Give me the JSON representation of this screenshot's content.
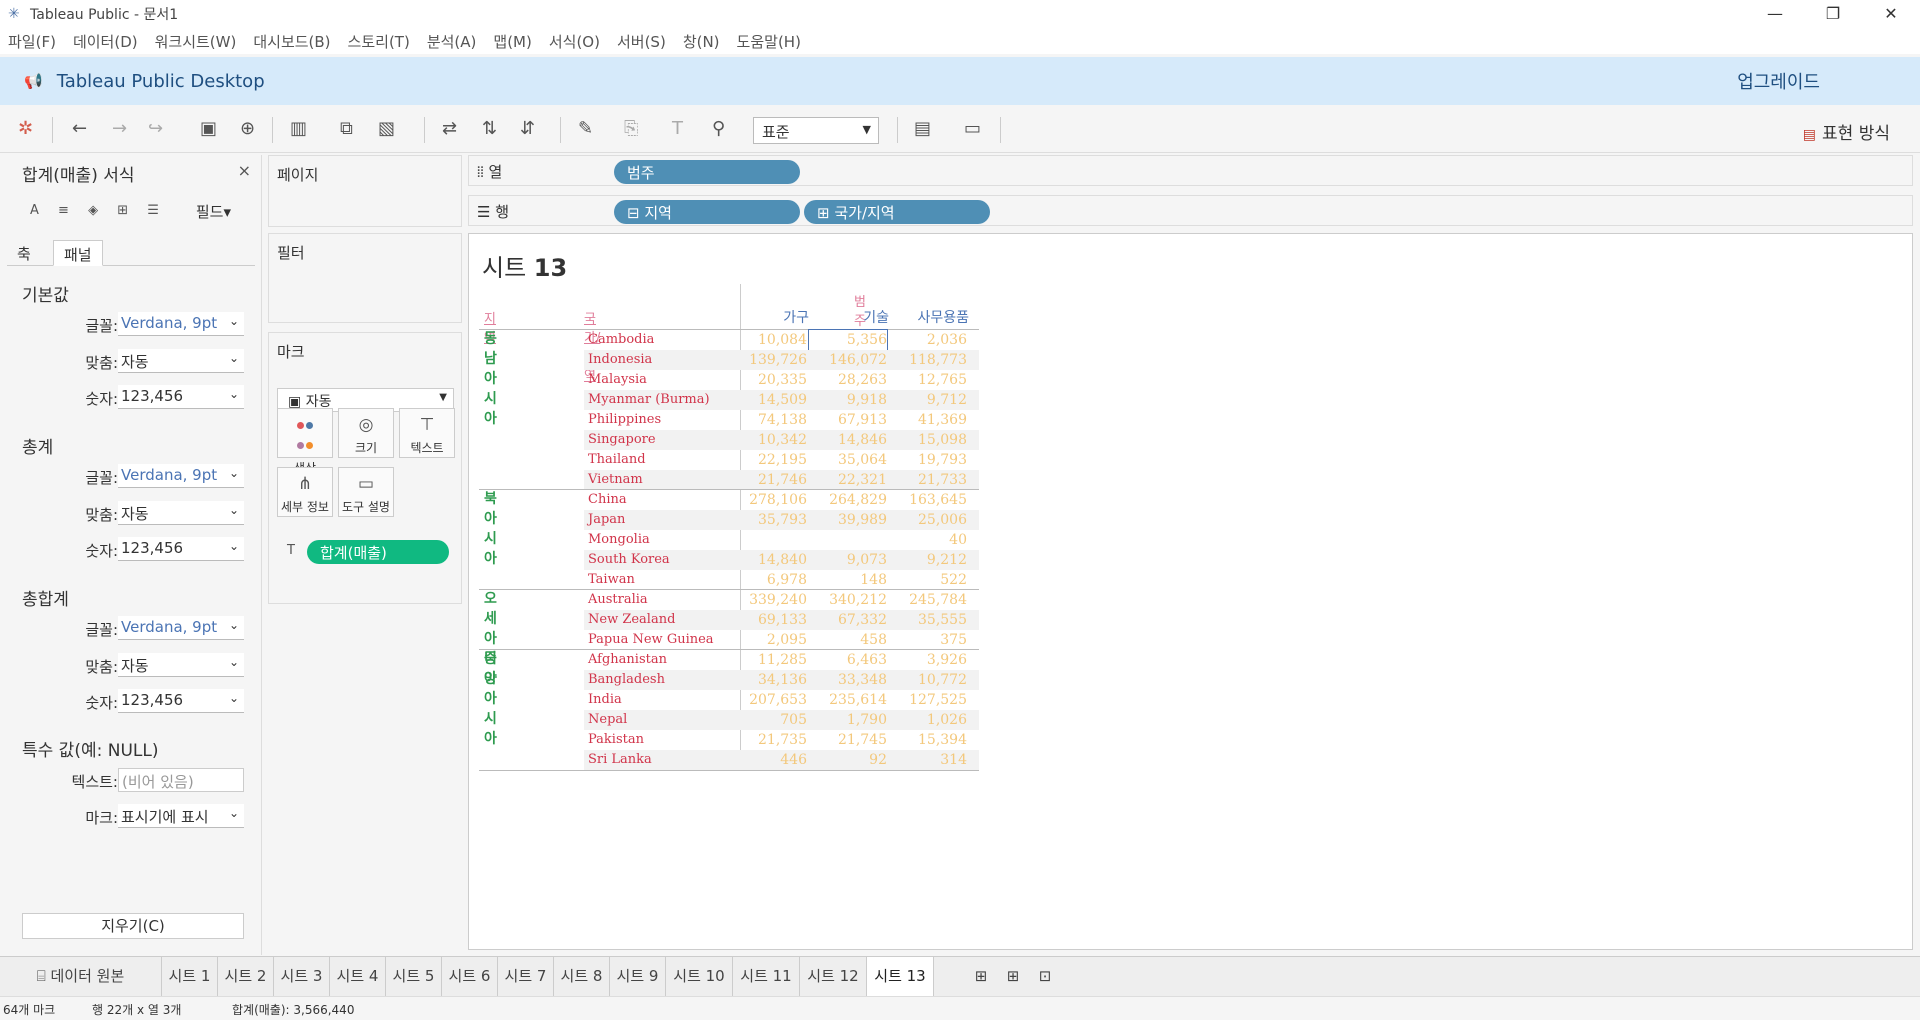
{
  "window": {
    "title": "Tableau Public - 문서1",
    "buttons": [
      "—",
      "❐",
      "✕"
    ]
  },
  "menu": [
    "파일(F)",
    "데이터(D)",
    "워크시트(W)",
    "대시보드(B)",
    "스토리(T)",
    "분석(A)",
    "맵(M)",
    "서식(O)",
    "서버(S)",
    "창(N)",
    "도움말(H)"
  ],
  "banner": {
    "name": "Tableau Public Desktop",
    "upgrade": "업그레이드"
  },
  "toolbar": {
    "fit": "표준",
    "show_me": "표현 방식"
  },
  "format_pane": {
    "title": "합계(매출) 서식",
    "fields_button": "필드",
    "tabs": [
      "축",
      "패널"
    ],
    "sections": [
      {
        "title": "기본값",
        "rows": [
          {
            "label": "글꼴:",
            "value": "Verdana, 9pt"
          },
          {
            "label": "맞춤:",
            "value": "자동"
          },
          {
            "label": "숫자:",
            "value": "123,456"
          }
        ]
      },
      {
        "title": "총계",
        "rows": [
          {
            "label": "글꼴:",
            "value": "Verdana, 9pt"
          },
          {
            "label": "맞춤:",
            "value": "자동"
          },
          {
            "label": "숫자:",
            "value": "123,456"
          }
        ]
      },
      {
        "title": "총합계",
        "rows": [
          {
            "label": "글꼴:",
            "value": "Verdana, 9pt"
          },
          {
            "label": "맞춤:",
            "value": "자동"
          },
          {
            "label": "숫자:",
            "value": "123,456"
          }
        ]
      }
    ],
    "special": {
      "title": "특수 값(예: NULL)",
      "text_label": "텍스트:",
      "text_placeholder": "(비어 있음)",
      "mark_label": "마크:",
      "mark_value": "표시기에 표시"
    },
    "clear_button": "지우기(C)"
  },
  "cards": {
    "pages": "페이지",
    "filters": "필터",
    "marks": "마크"
  },
  "marks": {
    "type": "자동",
    "buttons": [
      "색상",
      "크기",
      "텍스트",
      "세부 정보",
      "도구 설명"
    ],
    "pill": "합계(매출)"
  },
  "shelves": {
    "columns_label": "열",
    "rows_label": "행",
    "columns_pills": [
      "범주"
    ],
    "rows_pills": [
      "지역",
      "국가/지역"
    ]
  },
  "view": {
    "title_prefix": "시트 ",
    "title_num": "13",
    "col_group_header": "범주",
    "row_headers": [
      "지역",
      "국가/지역"
    ],
    "col_headers": [
      "가구",
      "기술",
      "사무용품"
    ],
    "groups": [
      {
        "region": "동남아시아",
        "rows": [
          {
            "country": "Cambodia",
            "values": [
              "10,084",
              "5,356",
              "2,036"
            ]
          },
          {
            "country": "Indonesia",
            "values": [
              "139,726",
              "146,072",
              "118,773"
            ]
          },
          {
            "country": "Malaysia",
            "values": [
              "20,335",
              "28,263",
              "12,765"
            ]
          },
          {
            "country": "Myanmar (Burma)",
            "values": [
              "14,509",
              "9,918",
              "9,712"
            ]
          },
          {
            "country": "Philippines",
            "values": [
              "74,138",
              "67,913",
              "41,369"
            ]
          },
          {
            "country": "Singapore",
            "values": [
              "10,342",
              "14,846",
              "15,098"
            ]
          },
          {
            "country": "Thailand",
            "values": [
              "22,195",
              "35,064",
              "19,793"
            ]
          },
          {
            "country": "Vietnam",
            "values": [
              "21,746",
              "22,321",
              "21,733"
            ]
          }
        ]
      },
      {
        "region": "북아시아",
        "rows": [
          {
            "country": "China",
            "values": [
              "278,106",
              "264,829",
              "163,645"
            ]
          },
          {
            "country": "Japan",
            "values": [
              "35,793",
              "39,989",
              "25,006"
            ]
          },
          {
            "country": "Mongolia",
            "values": [
              "",
              "",
              "40"
            ]
          },
          {
            "country": "South Korea",
            "values": [
              "14,840",
              "9,073",
              "9,212"
            ]
          },
          {
            "country": "Taiwan",
            "values": [
              "6,978",
              "148",
              "522"
            ]
          }
        ]
      },
      {
        "region": "오세아니아",
        "rows": [
          {
            "country": "Australia",
            "values": [
              "339,240",
              "340,212",
              "245,784"
            ]
          },
          {
            "country": "New Zealand",
            "values": [
              "69,133",
              "67,332",
              "35,555"
            ]
          },
          {
            "country": "Papua New Guinea",
            "values": [
              "2,095",
              "458",
              "375"
            ]
          }
        ]
      },
      {
        "region": "중앙아시아",
        "rows": [
          {
            "country": "Afghanistan",
            "values": [
              "11,285",
              "6,463",
              "3,926"
            ]
          },
          {
            "country": "Bangladesh",
            "values": [
              "34,136",
              "33,348",
              "10,772"
            ]
          },
          {
            "country": "India",
            "values": [
              "207,653",
              "235,614",
              "127,525"
            ]
          },
          {
            "country": "Nepal",
            "values": [
              "705",
              "1,790",
              "1,026"
            ]
          },
          {
            "country": "Pakistan",
            "values": [
              "21,735",
              "21,745",
              "15,394"
            ]
          },
          {
            "country": "Sri Lanka",
            "values": [
              "446",
              "92",
              "314"
            ]
          }
        ]
      }
    ]
  },
  "sheet_tabs": {
    "datasource": "데이터 원본",
    "sheets": [
      "시트 1",
      "시트 2",
      "시트 3",
      "시트 4",
      "시트 5",
      "시트 6",
      "시트 7",
      "시트 8",
      "시트 9",
      "시트 10",
      "시트 11",
      "시트 12",
      "시트 13"
    ],
    "active": "시트 13"
  },
  "status": {
    "marks": "64개 마크",
    "rows_cols": "행 22개 x 열 3개",
    "sum": "합계(매출): 3,566,440"
  },
  "colors": {
    "banner": "#d6eafa",
    "pill_blue": "#4f8fb5",
    "pill_green": "#10b981",
    "region": "#2e9b4f",
    "country": "#d1344a",
    "value": "#f3c87c"
  }
}
